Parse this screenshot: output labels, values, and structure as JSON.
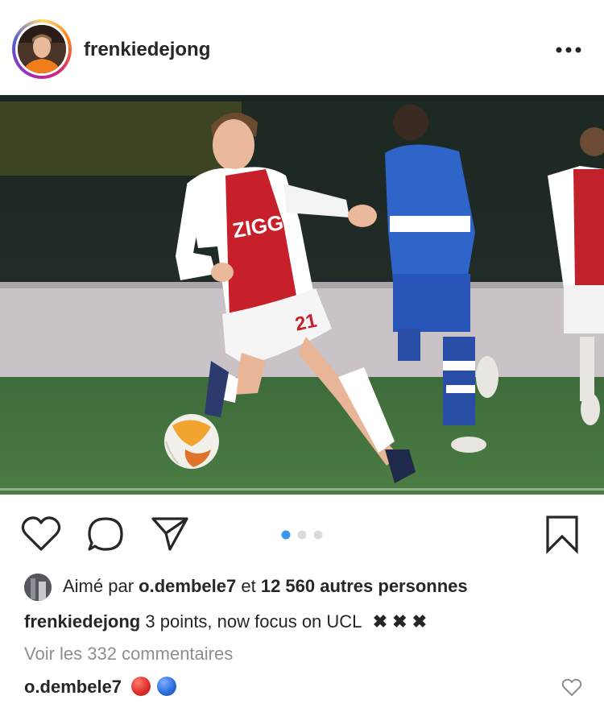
{
  "header": {
    "username": "frenkiedejong",
    "more_icon": "more-horizontal-icon"
  },
  "post": {
    "jersey_sponsor": "ZIGGO",
    "jersey_number": "21",
    "pagination": {
      "current": 1,
      "total": 3,
      "active_color": "#3897f0",
      "inactive_color": "#dbdbdb"
    }
  },
  "actions": {
    "like_icon": "heart-icon",
    "comment_icon": "comment-icon",
    "share_icon": "send-icon",
    "save_icon": "bookmark-icon"
  },
  "likes": {
    "prefix": "Aimé par",
    "user": "o.dembele7",
    "conjunction": "et",
    "count_text": "12 560 autres personnes"
  },
  "caption": {
    "username": "frenkiedejong",
    "text": "3 points, now focus on UCL",
    "marks": "✖✖✖"
  },
  "view_comments": "Voir les 332 commentaires",
  "comment": {
    "username": "o.dembele7",
    "emoji_colors": [
      "#e0312b",
      "#2f6fdc"
    ]
  }
}
